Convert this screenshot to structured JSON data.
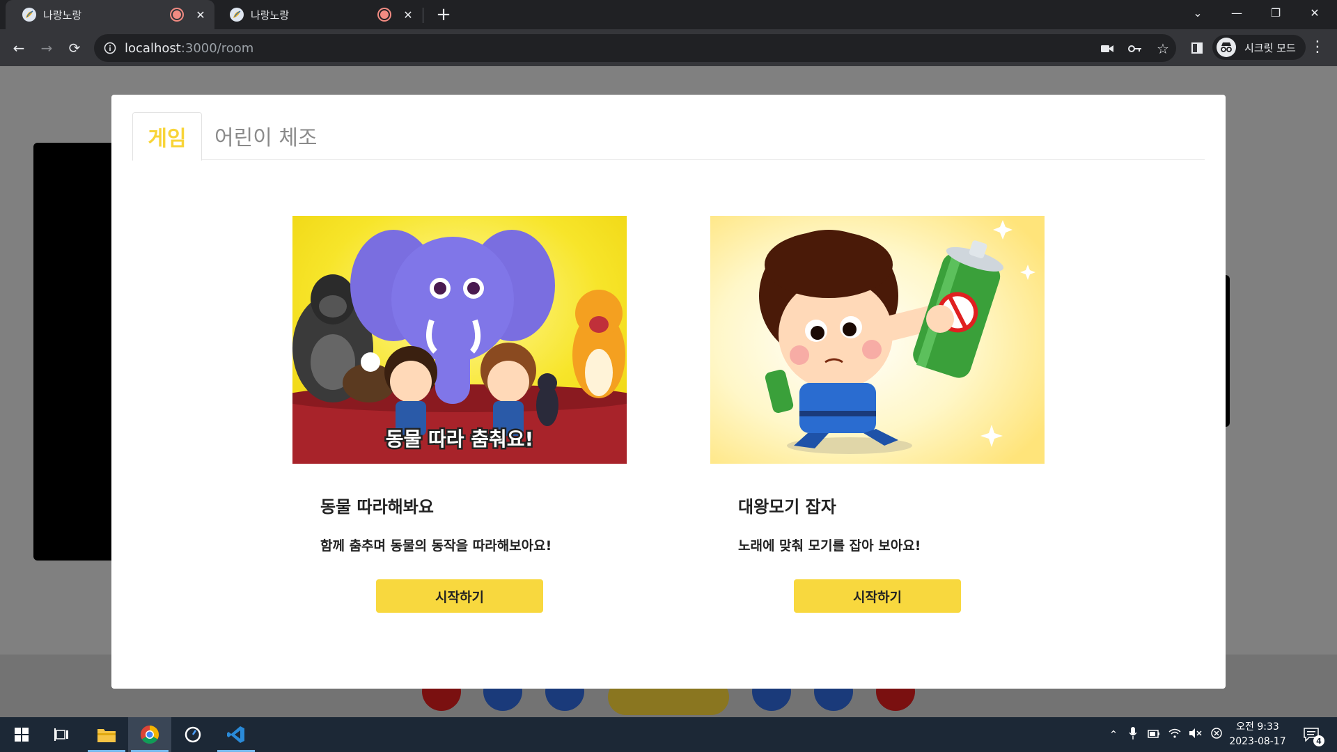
{
  "browser": {
    "tabs": [
      {
        "title": "나랑노랑",
        "active": true
      },
      {
        "title": "나랑노랑",
        "active": false
      }
    ],
    "url_host": "localhost",
    "url_path": ":3000/room",
    "profile_label": "시크릿 모드"
  },
  "modal": {
    "tabs": [
      {
        "label": "게임",
        "active": true
      },
      {
        "label": "어린이 체조",
        "active": false
      }
    ],
    "cards": [
      {
        "title": "동물 따라해봐요",
        "description": "함께 춤추며 동물의 동작을 따라해보아요!",
        "button_label": "시작하기",
        "thumbnail_caption": "동물 따라 춤춰요!"
      },
      {
        "title": "대왕모기 잡자",
        "description": "노래에 맞춰 모기를 잡아 보아요!",
        "button_label": "시작하기"
      }
    ]
  },
  "taskbar": {
    "time": "오전 9:33",
    "date": "2023-08-17",
    "notification_count": "4"
  },
  "colors": {
    "accent_yellow": "#f8d437",
    "button_yellow": "#f8d83e",
    "chrome_dark": "#202124",
    "taskbar": "#1c2836"
  }
}
